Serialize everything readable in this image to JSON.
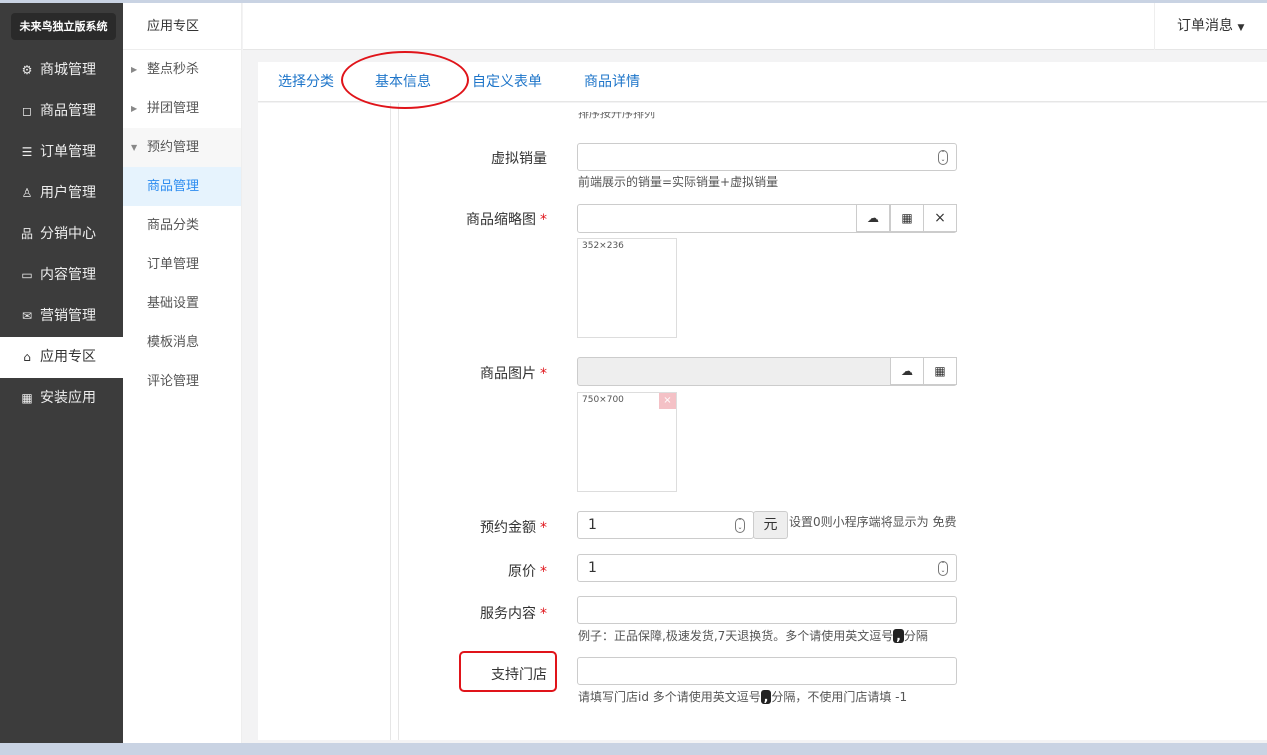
{
  "app": {
    "logo": "未来鸟独立版系统"
  },
  "nav": [
    {
      "icon": "gear-icon",
      "glyph": "⚙",
      "label": "商城管理"
    },
    {
      "icon": "bag-icon",
      "glyph": "◻",
      "label": "商品管理"
    },
    {
      "icon": "list-icon",
      "glyph": "☰",
      "label": "订单管理"
    },
    {
      "icon": "user-icon",
      "glyph": "♙",
      "label": "用户管理"
    },
    {
      "icon": "sitemap-icon",
      "glyph": "品",
      "label": "分销中心"
    },
    {
      "icon": "content-icon",
      "glyph": "▭",
      "label": "内容管理"
    },
    {
      "icon": "ticket-icon",
      "glyph": "✉",
      "label": "营销管理"
    },
    {
      "icon": "puzzle-icon",
      "glyph": "⌂",
      "label": "应用专区",
      "active": true
    },
    {
      "icon": "grid-icon",
      "glyph": "▦",
      "label": "安装应用"
    }
  ],
  "sub": {
    "title": "应用专区",
    "items": [
      "整点秒杀",
      "拼团管理",
      "预约管理",
      "商品管理",
      "商品分类",
      "订单管理",
      "基础设置",
      "模板消息",
      "评论管理"
    ]
  },
  "header": {
    "right": "订单消息"
  },
  "tabs": [
    "选择分类",
    "基本信息",
    "自定义表单",
    "商品详情"
  ],
  "form": {
    "cut_help": "排序按升序排列",
    "virtual_sales": {
      "label": "虚拟销量",
      "value": "",
      "help": "前端展示的销量=实际销量+虚拟销量"
    },
    "thumb": {
      "label": "商品缩略图",
      "size": "352×236",
      "close": "×"
    },
    "images": {
      "label": "商品图片",
      "size": "750×700",
      "delete": "×"
    },
    "price": {
      "label": "预约金额",
      "value": "1",
      "unit": "元",
      "help": "设置0则小程序端将显示为 免费"
    },
    "orig": {
      "label": "原价",
      "value": "1"
    },
    "service": {
      "label": "服务内容",
      "value": "",
      "help_a": "例子：正品保障,极速发货,7天退换货。多个请使用英文逗号",
      "comma": ",",
      "help_b": "分隔"
    },
    "stores": {
      "label": "支持门店",
      "value": "",
      "help_a": "请填写门店id 多个请使用英文逗号",
      "comma": ",",
      "help_b": "分隔，不使用门店请填 -1"
    },
    "required_mark": "*"
  }
}
